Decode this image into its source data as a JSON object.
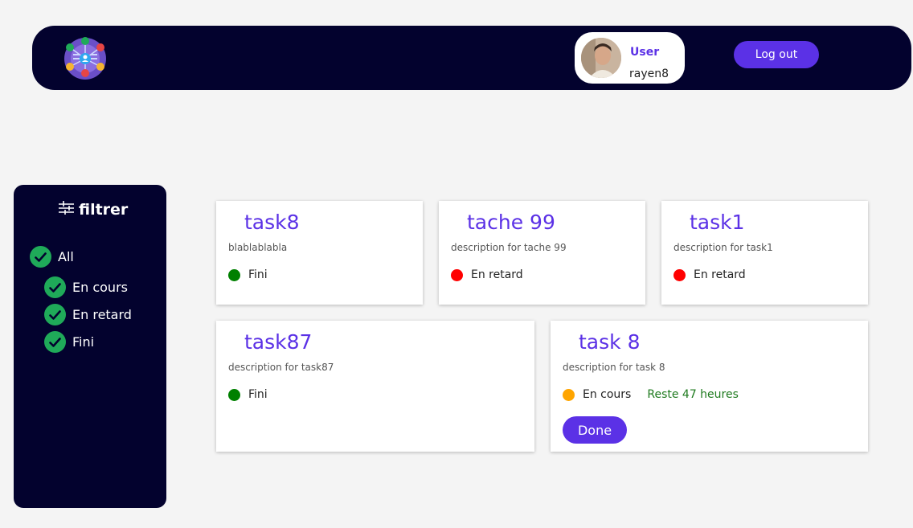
{
  "header": {
    "logo_icon": "task-network-logo-icon",
    "user_role": "User",
    "username": "rayen8",
    "logout_label": "Log out"
  },
  "filter": {
    "title": "filtrer",
    "icon": "sliders-icon",
    "items": [
      {
        "label": "All",
        "checked": true
      },
      {
        "label": "En cours",
        "checked": true
      },
      {
        "label": "En retard",
        "checked": true
      },
      {
        "label": "Fini",
        "checked": true
      }
    ]
  },
  "tasks": [
    {
      "title": "task8",
      "description": "blablablabla",
      "status": "Fini",
      "status_color": "#008000"
    },
    {
      "title": "tache 99",
      "description": "description for tache 99",
      "status": "En retard",
      "status_color": "#ff0000"
    },
    {
      "title": "task1",
      "description": "description for task1",
      "status": "En retard",
      "status_color": "#ff0000"
    },
    {
      "title": "task87",
      "description": "description for task87",
      "status": "Fini",
      "status_color": "#008000"
    },
    {
      "title": "task 8",
      "description": "description for task 8",
      "status": "En cours",
      "status_color": "#ffa500",
      "remaining": "Reste 47 heures",
      "action_label": "Done"
    }
  ],
  "colors": {
    "navy": "#03022e",
    "accent": "#5b31e6",
    "check_green": "#1faa59",
    "remaining_green": "#1e7a1e"
  }
}
